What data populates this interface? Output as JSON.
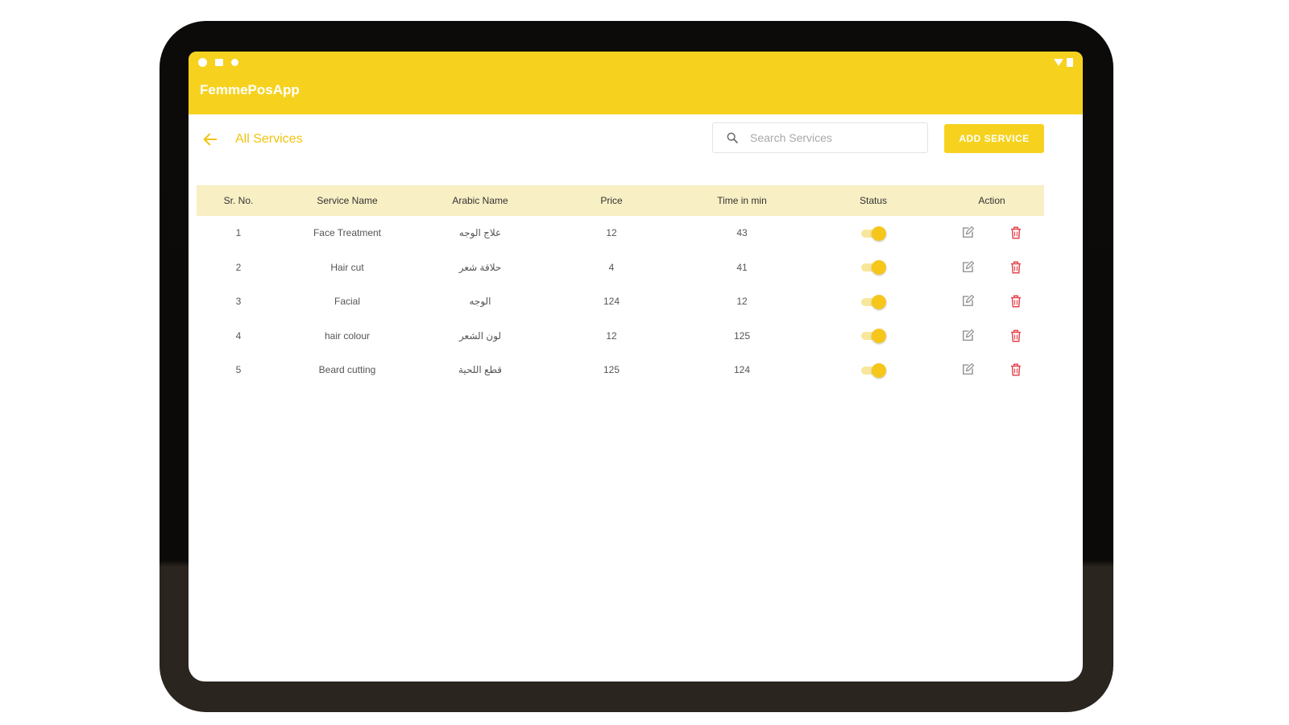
{
  "app": {
    "title": "FemmePosApp"
  },
  "page": {
    "title": "All Services"
  },
  "search": {
    "placeholder": "Search Services",
    "value": ""
  },
  "toolbar": {
    "add_label": "ADD SERVICE"
  },
  "colors": {
    "accent": "#f6d21e",
    "header_row": "#f8efc4",
    "delete": "#e3474f",
    "title_text": "#f1c40f"
  },
  "icons": {
    "back": "arrow-left-icon",
    "search": "search-icon",
    "edit": "edit-icon",
    "delete": "trash-icon"
  },
  "table": {
    "headers": [
      "Sr. No.",
      "Service Name",
      "Arabic Name",
      "Price",
      "Time in min",
      "Status",
      "Action"
    ],
    "rows": [
      {
        "sr": "1",
        "name": "Face Treatment",
        "arabic": "علاج الوجه",
        "price": "12",
        "time": "43",
        "status": "on"
      },
      {
        "sr": "2",
        "name": "Hair cut",
        "arabic": "حلاقة شعر",
        "price": "4",
        "time": "41",
        "status": "on"
      },
      {
        "sr": "3",
        "name": "Facial",
        "arabic": "الوجه",
        "price": "124",
        "time": "12",
        "status": "on"
      },
      {
        "sr": "4",
        "name": "hair colour",
        "arabic": "لون الشعر",
        "price": "12",
        "time": "125",
        "status": "on"
      },
      {
        "sr": "5",
        "name": "Beard cutting",
        "arabic": "قطع اللحية",
        "price": "125",
        "time": "124",
        "status": "on"
      }
    ]
  }
}
